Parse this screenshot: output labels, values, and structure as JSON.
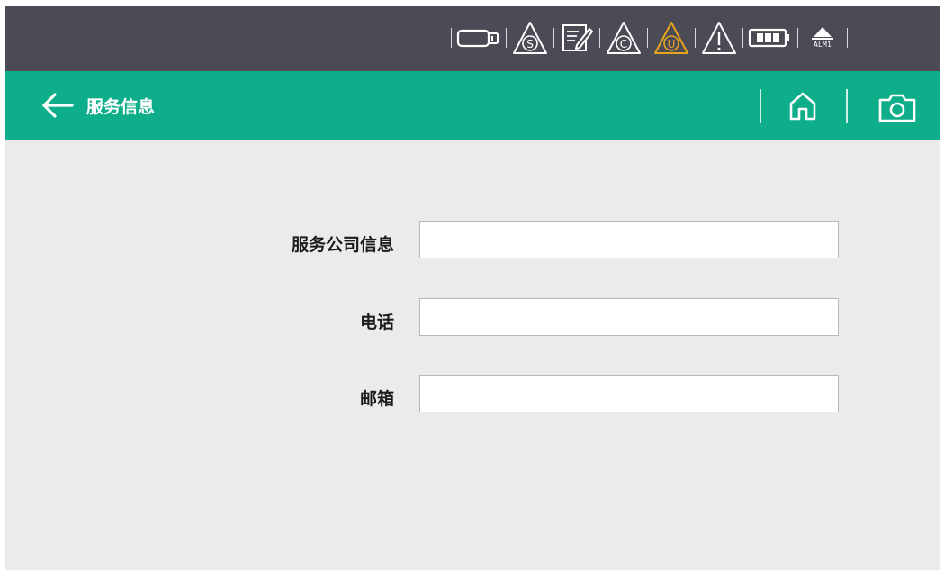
{
  "status_bar": {
    "icons": [
      "usb-drive-icon",
      "warning-s-icon",
      "edit-note-icon",
      "warning-c-icon",
      "warning-u-icon",
      "warning-icon",
      "battery-icon",
      "alarm-icon"
    ],
    "alarm_label": "ALM1",
    "colors": {
      "background": "#4b4b56",
      "warning_active": "#e8a31c",
      "icon": "#ffffff"
    }
  },
  "header": {
    "title": "服务信息",
    "background": "#0fae8a",
    "icons": [
      "back-arrow-icon",
      "home-icon",
      "camera-icon"
    ]
  },
  "form": {
    "fields": [
      {
        "label": "服务公司信息",
        "value": ""
      },
      {
        "label": "电话",
        "value": ""
      },
      {
        "label": "邮箱",
        "value": ""
      }
    ]
  }
}
